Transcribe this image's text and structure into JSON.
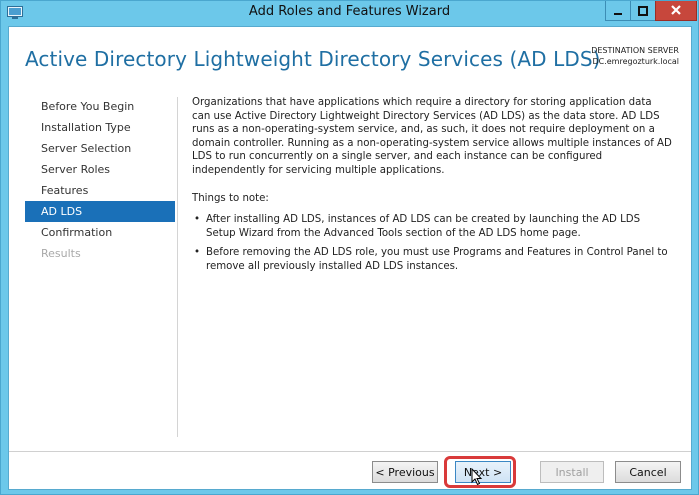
{
  "window": {
    "title": "Add Roles and Features Wizard",
    "icons": [
      "server-manager-icon",
      "minimize-icon",
      "maximize-icon",
      "close-icon"
    ]
  },
  "header": {
    "title": "Active Directory Lightweight Directory Services (AD LDS)",
    "destination_label": "DESTINATION SERVER",
    "destination_server": "DC.emregozturk.local"
  },
  "nav": {
    "items": [
      {
        "label": "Before You Begin",
        "state": "normal"
      },
      {
        "label": "Installation Type",
        "state": "normal"
      },
      {
        "label": "Server Selection",
        "state": "normal"
      },
      {
        "label": "Server Roles",
        "state": "normal"
      },
      {
        "label": "Features",
        "state": "normal"
      },
      {
        "label": "AD LDS",
        "state": "selected"
      },
      {
        "label": "Confirmation",
        "state": "normal"
      },
      {
        "label": "Results",
        "state": "disabled"
      }
    ]
  },
  "content": {
    "intro": "Organizations that have applications which require a directory for storing application data can use Active Directory Lightweight Directory Services (AD LDS) as the data store. AD LDS runs as a non-operating-system service, and, as such, it does not require deployment on a domain controller. Running as a non-operating-system service allows multiple instances of AD LDS to run concurrently on a single server, and each instance can be configured independently for servicing multiple applications.",
    "notes_heading": "Things to note:",
    "bullet_char": "•",
    "notes": [
      "After installing AD LDS, instances of AD LDS can be created by launching the AD LDS Setup Wizard from the Advanced Tools section of the AD LDS home page.",
      "Before removing the AD LDS role, you must use Programs and Features in Control Panel to remove all previously installed AD LDS instances."
    ]
  },
  "footer": {
    "previous_label": "< Previous",
    "next_label": "Next >",
    "install_label": "Install",
    "cancel_label": "Cancel"
  },
  "colors": {
    "frame": "#6cc8ea",
    "accent": "#1a70b8",
    "title_text": "#1f6fa3",
    "highlight": "#d93a3a",
    "close": "#c7473c"
  }
}
